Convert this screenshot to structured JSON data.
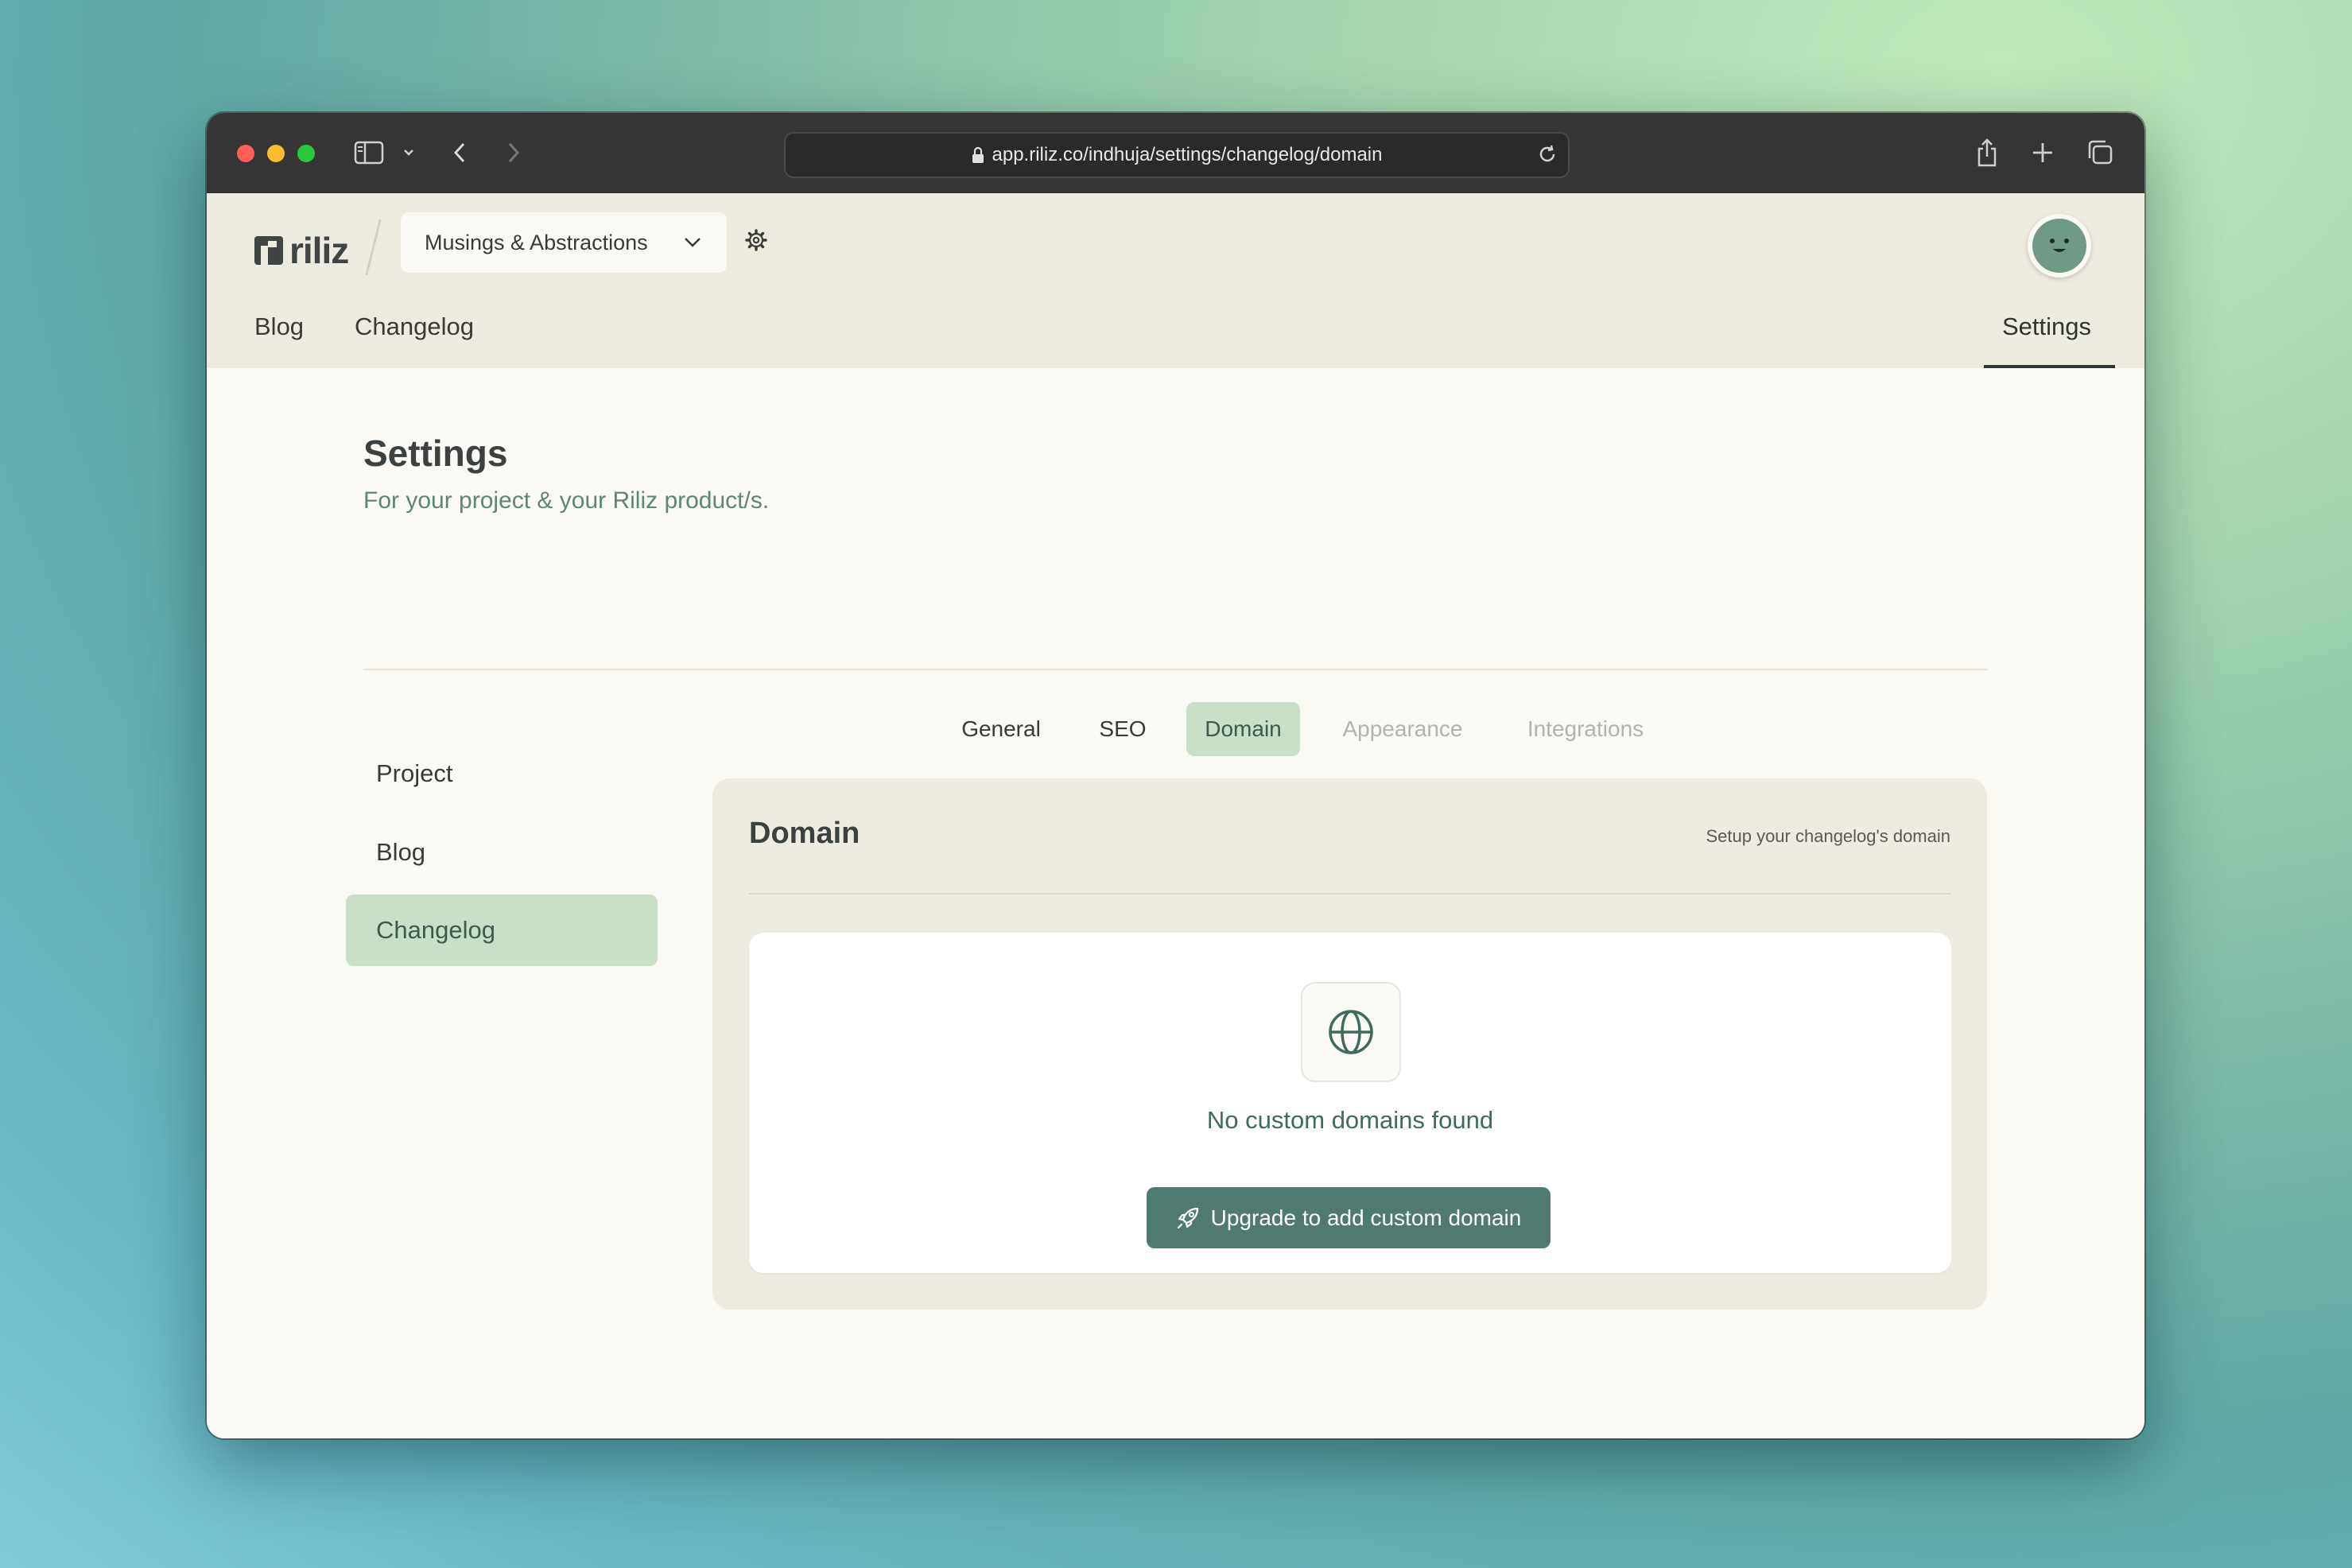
{
  "browser": {
    "url": "app.riliz.co/indhuja/settings/changelog/domain"
  },
  "header": {
    "logo_text": "riliz",
    "project_name": "Musings & Abstractions",
    "nav": {
      "blog": "Blog",
      "changelog": "Changelog",
      "settings": "Settings"
    }
  },
  "page": {
    "title": "Settings",
    "subtitle": "For your project & your Riliz product/s."
  },
  "sidebar": {
    "items": [
      {
        "label": "Project"
      },
      {
        "label": "Blog"
      },
      {
        "label": "Changelog"
      }
    ]
  },
  "tabs": [
    {
      "label": "General"
    },
    {
      "label": "SEO"
    },
    {
      "label": "Domain"
    },
    {
      "label": "Appearance"
    },
    {
      "label": "Integrations"
    }
  ],
  "panel": {
    "title": "Domain",
    "hint": "Setup your changelog's domain",
    "empty_message": "No custom domains found",
    "upgrade_button": "Upgrade to add custom domain"
  },
  "icons": {
    "project_selector": "chevron-down-icon",
    "project_settings": "gear-icon",
    "empty_state": "globe-icon",
    "upgrade": "rocket-icon"
  },
  "colors": {
    "accent": "#4f7a72",
    "active_bg": "#c9dfc7",
    "header_bg": "#eeece0",
    "page_bg": "#faf9f4"
  }
}
